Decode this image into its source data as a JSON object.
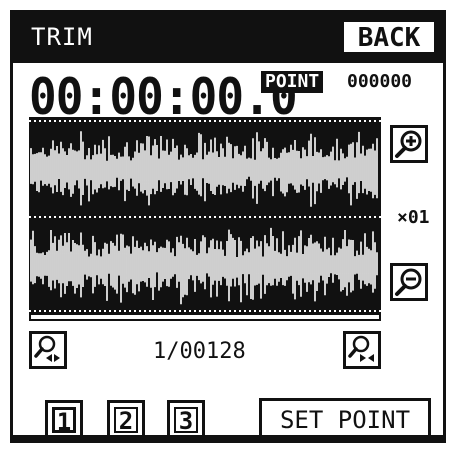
{
  "header": {
    "title": "TRIM",
    "back_label": "BACK"
  },
  "time": {
    "timecode": "00:00:00.0",
    "point_label": "POINT",
    "point_value": "000000"
  },
  "waveform": {
    "zoom_level": "×01"
  },
  "navigation": {
    "page_indicator": "1/00128"
  },
  "tracks": [
    {
      "label": "1",
      "active": true
    },
    {
      "label": "2",
      "active": false
    },
    {
      "label": "3",
      "active": false
    }
  ],
  "actions": {
    "set_point_label": "SET POINT"
  },
  "icons": {
    "zoom_in": "zoom-in-icon",
    "zoom_out": "zoom-out-icon",
    "zoom_reset_left": "zoom-to-start-icon",
    "zoom_reset_right": "zoom-fit-icon"
  },
  "colors": {
    "foreground": "#111111",
    "background": "#ffffff"
  }
}
